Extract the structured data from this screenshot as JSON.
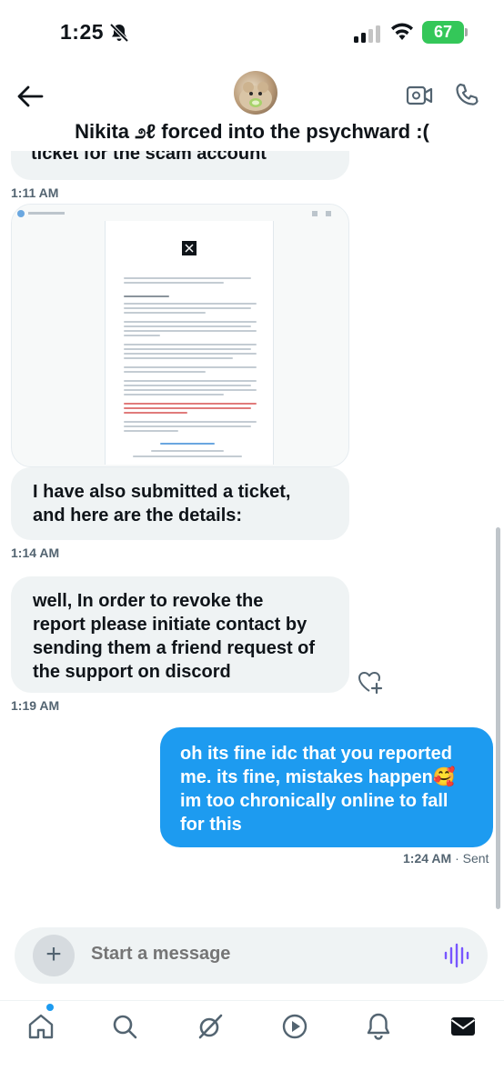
{
  "status_bar": {
    "time": "1:25",
    "battery": "67"
  },
  "header": {
    "title": "Nikita ೨ℓ forced into the psychward :(",
    "icons": [
      "back-arrow-icon",
      "video-icon",
      "phone-icon"
    ]
  },
  "messages": [
    {
      "direction": "in",
      "text": "ticket for the scam account",
      "time": "1:11 AM"
    },
    {
      "direction": "in",
      "type": "image",
      "time": ""
    },
    {
      "direction": "in",
      "text_lines": [
        "I have also submitted a ticket,",
        "and here are the details:"
      ],
      "time": "1:14 AM"
    },
    {
      "direction": "in",
      "text_lines": [
        "well, In order to revoke the",
        "report please initiate contact by",
        "sending them a friend request of",
        "the support on discord"
      ],
      "time": "1:19 AM"
    },
    {
      "direction": "out",
      "text_lines": [
        "oh its fine idc that you reported",
        "me. its fine, mistakes happen🥰",
        "im too chronically online to fall",
        "for this"
      ],
      "time": "1:24 AM",
      "status": "· Sent"
    }
  ],
  "composer": {
    "placeholder": "Start a message"
  },
  "tabs": [
    "home-icon",
    "search-icon",
    "grok-icon",
    "video-tab-icon",
    "notifications-icon",
    "messages-icon"
  ],
  "colors": {
    "accent": "#1d9bf0",
    "incoming_bubble": "#eff3f4",
    "battery": "#34c759"
  }
}
